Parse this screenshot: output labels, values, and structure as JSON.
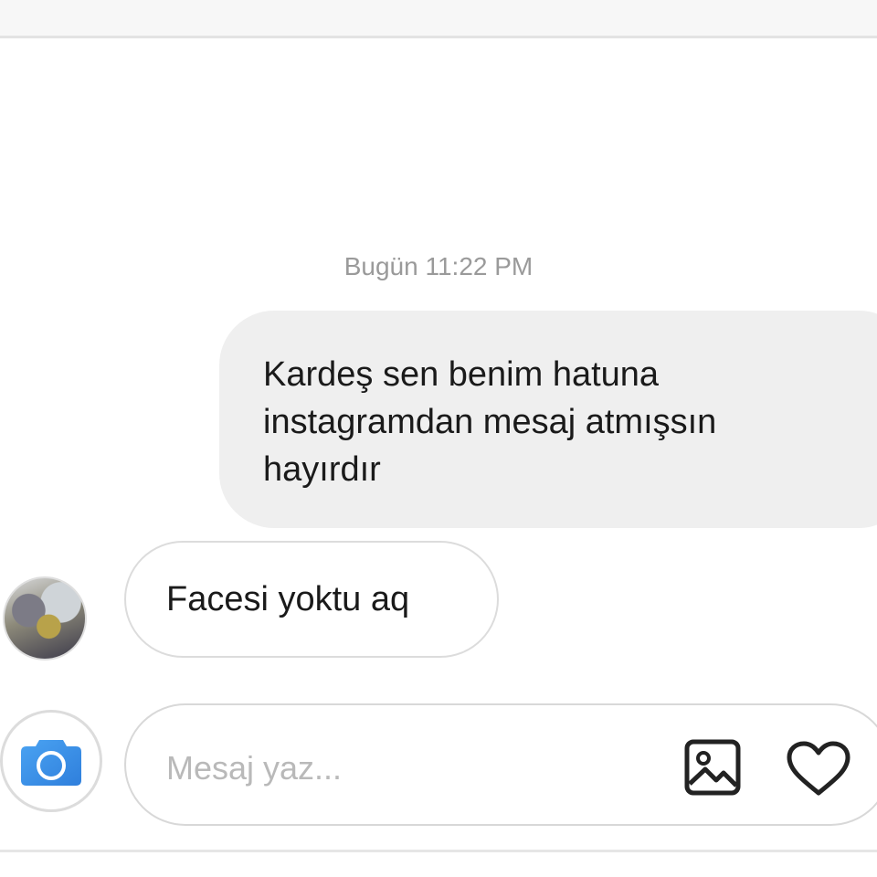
{
  "conversation": {
    "timestamp": "Bugün 11:22 PM",
    "messages": [
      {
        "direction": "outgoing",
        "text": "Kardeş sen benim hatuna\ninstagramdan mesaj atmışsın\nhayırdır"
      },
      {
        "direction": "incoming",
        "text": "Facesi yoktu aq"
      }
    ]
  },
  "composer": {
    "placeholder": "Mesaj yaz...",
    "camera_icon": "camera-icon",
    "gallery_icon": "image-icon",
    "like_icon": "heart-icon"
  },
  "colors": {
    "accent": "#3d8fe6",
    "outgoing_bubble": "#efefef",
    "text": "#1a1a1a",
    "muted": "#9a9a9a"
  }
}
